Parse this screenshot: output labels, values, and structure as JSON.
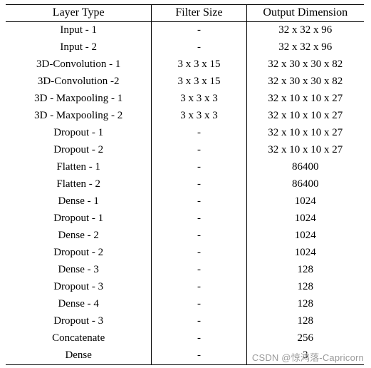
{
  "table": {
    "headers": [
      "Layer Type",
      "Filter Size",
      "Output Dimension"
    ],
    "rows": [
      [
        "Input - 1",
        "-",
        "32 x 32 x 96"
      ],
      [
        "Input - 2",
        "-",
        "32 x 32 x 96"
      ],
      [
        "3D-Convolution - 1",
        "3 x 3 x 15",
        "32 x 30 x 30 x 82"
      ],
      [
        "3D-Convolution -2",
        "3 x 3 x 15",
        "32 x 30 x 30 x 82"
      ],
      [
        "3D - Maxpooling - 1",
        "3 x 3 x 3",
        "32 x 10 x 10 x 27"
      ],
      [
        "3D - Maxpooling - 2",
        "3 x 3 x 3",
        "32 x 10 x 10 x 27"
      ],
      [
        "Dropout - 1",
        "-",
        "32 x 10 x 10 x 27"
      ],
      [
        "Dropout - 2",
        "-",
        "32 x 10 x 10 x 27"
      ],
      [
        "Flatten - 1",
        "-",
        "86400"
      ],
      [
        "Flatten - 2",
        "-",
        "86400"
      ],
      [
        "Dense - 1",
        "-",
        "1024"
      ],
      [
        "Dropout - 1",
        "-",
        "1024"
      ],
      [
        "Dense - 2",
        "-",
        "1024"
      ],
      [
        "Dropout - 2",
        "-",
        "1024"
      ],
      [
        "Dense - 3",
        "-",
        "128"
      ],
      [
        "Dropout - 3",
        "-",
        "128"
      ],
      [
        "Dense - 4",
        "-",
        "128"
      ],
      [
        "Dropout - 3",
        "-",
        "128"
      ],
      [
        "Concatenate",
        "-",
        "256"
      ],
      [
        "Dense",
        "-",
        "3"
      ]
    ]
  },
  "watermark": {
    "text": "CSDN @惊鸿落-Capricorn"
  }
}
